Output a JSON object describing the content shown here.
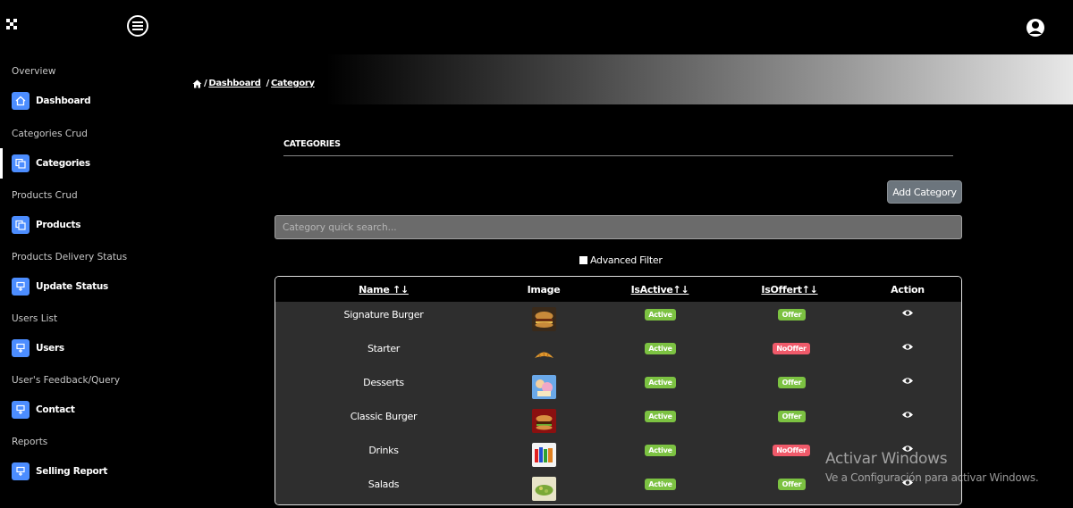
{
  "header": {
    "logo_icon": "grid-icon",
    "menu_icon": "hamburger-icon",
    "user_icon": "user-avatar-icon"
  },
  "sidebar": {
    "sections": [
      {
        "title": "Overview",
        "item": {
          "label": "Dashboard",
          "icon": "home-icon"
        }
      },
      {
        "title": "Categories Crud",
        "item": {
          "label": "Categories",
          "icon": "copy-icon",
          "active": true
        }
      },
      {
        "title": "Products Crud",
        "item": {
          "label": "Products",
          "icon": "copy-icon"
        }
      },
      {
        "title": "Products Delivery Status",
        "item": {
          "label": "Update Status",
          "icon": "clipboard-icon"
        }
      },
      {
        "title": "Users List",
        "item": {
          "label": "Users",
          "icon": "clipboard-icon"
        }
      },
      {
        "title": "User's Feedback/Query",
        "item": {
          "label": "Contact",
          "icon": "clipboard-icon"
        }
      },
      {
        "title": "Reports",
        "item": {
          "label": "Selling Report",
          "icon": "clipboard-icon"
        }
      }
    ]
  },
  "breadcrumb": {
    "home_icon": "home-icon",
    "sep": "/",
    "items": [
      "Dashboard",
      "Category"
    ]
  },
  "main": {
    "section_title": "CATEGORIES",
    "add_button": "Add Category",
    "search_placeholder": "Category quick search...",
    "advanced_filter": "Advanced Filter"
  },
  "table": {
    "headers": [
      "Name ↑↓",
      "Image",
      "IsActive↑↓",
      "IsOffert↑↓",
      "Action"
    ],
    "rows": [
      {
        "name": "Signature Burger",
        "image_icon": "burger-image",
        "active": "Active",
        "offer": "Offer",
        "offer_color": "#7cc242"
      },
      {
        "name": "Starter",
        "image_icon": "croissant-image",
        "active": "Active",
        "offer": "NoOffer",
        "offer_color": "#f05a6a"
      },
      {
        "name": "Desserts",
        "image_icon": "dessert-image",
        "active": "Active",
        "offer": "Offer",
        "offer_color": "#7cc242"
      },
      {
        "name": "Classic Burger",
        "image_icon": "burger-image",
        "active": "Active",
        "offer": "Offer",
        "offer_color": "#7cc242"
      },
      {
        "name": "Drinks",
        "image_icon": "drinks-image",
        "active": "Active",
        "offer": "NoOffer",
        "offer_color": "#f05a6a"
      },
      {
        "name": "Salads",
        "image_icon": "salad-image",
        "active": "Active",
        "offer": "Offer",
        "offer_color": "#7cc242"
      }
    ]
  },
  "watermark": {
    "title": "Activar Windows",
    "subtitle": "Ve a Configuración para activar Windows."
  },
  "colors": {
    "accent": "#4c8dff",
    "active_badge": "#7cc242",
    "nooffer_badge": "#f05a6a",
    "button": "#6c757d"
  }
}
